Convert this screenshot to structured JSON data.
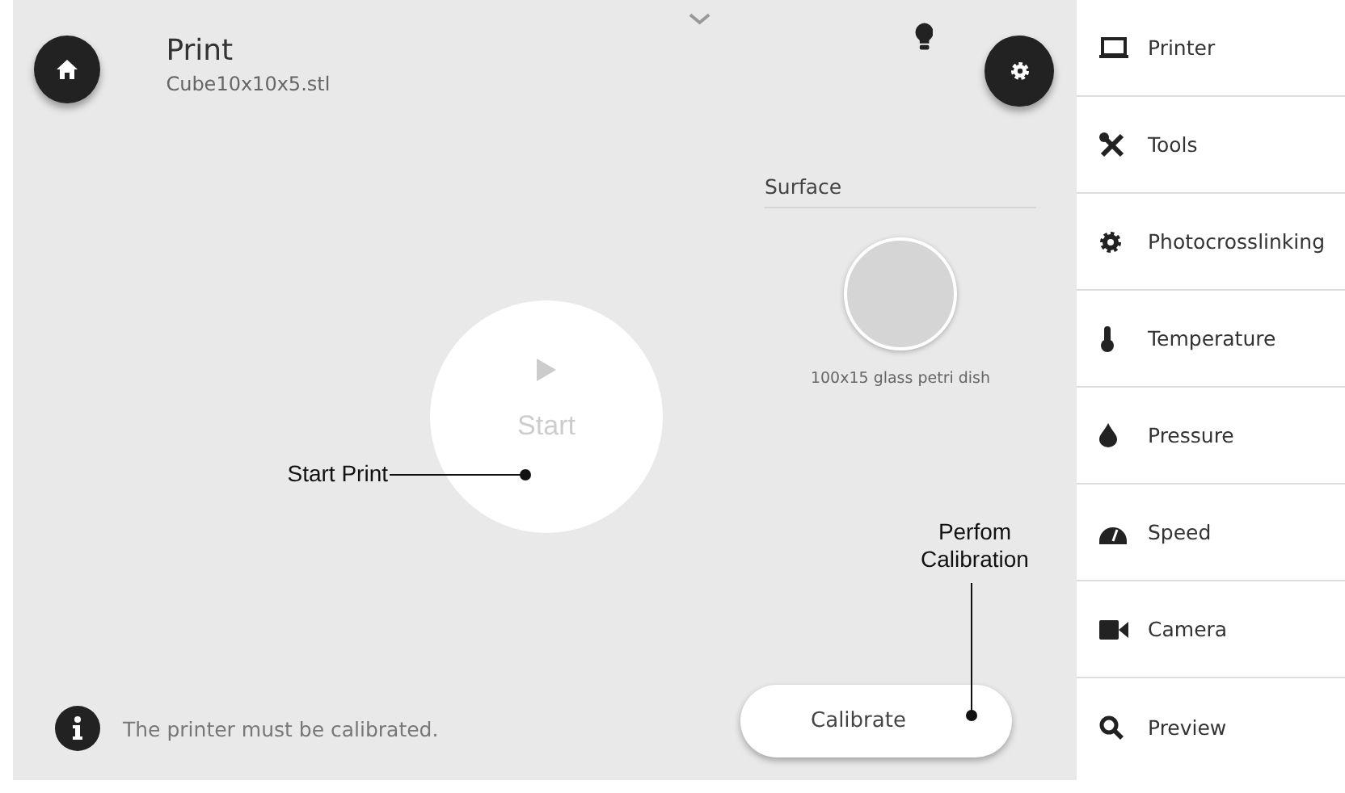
{
  "header": {
    "title": "Print",
    "filename": "Cube10x10x5.stl"
  },
  "surface": {
    "label": "Surface",
    "caption": "100x15 glass petri dish"
  },
  "start_button": {
    "label": "Start",
    "disabled": true
  },
  "status": {
    "message": "The printer must be calibrated."
  },
  "calibrate_button": {
    "label": "Calibrate"
  },
  "callouts": [
    {
      "kind": "horizontal",
      "text": "Start Print"
    },
    {
      "kind": "vertical",
      "text": "Perfom Calibration"
    }
  ],
  "sidebar": {
    "items": [
      {
        "label": "Printer"
      },
      {
        "label": "Tools"
      },
      {
        "label": "Photocrosslinking"
      },
      {
        "label": "Temperature"
      },
      {
        "label": "Pressure"
      },
      {
        "label": "Speed"
      },
      {
        "label": "Camera"
      },
      {
        "label": "Preview"
      }
    ]
  }
}
